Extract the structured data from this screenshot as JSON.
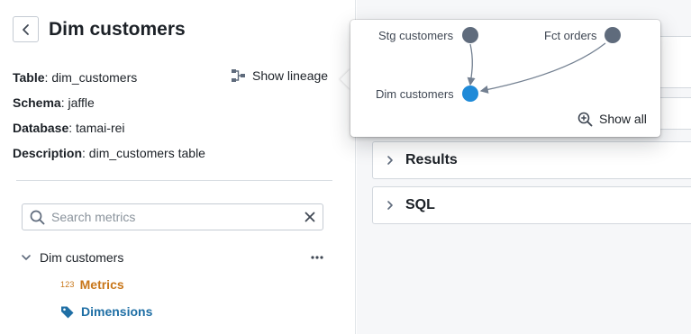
{
  "header": {
    "title": "Dim customers"
  },
  "details": {
    "table_label": "Table",
    "table_value": "dim_customers",
    "schema_label": "Schema",
    "schema_value": "jaffle",
    "database_label": "Database",
    "database_value": "tamai-rei",
    "description_label": "Description",
    "description_value": "dim_customers table"
  },
  "lineage_button": {
    "label": "Show lineage",
    "icon": "lineage-icon"
  },
  "search": {
    "placeholder": "Search metrics",
    "value": ""
  },
  "tree": {
    "root_label": "Dim customers",
    "items": [
      {
        "icon_text": "123",
        "label": "Metrics",
        "color": "#c87619"
      },
      {
        "icon": "tag-icon",
        "label": "Dimensions",
        "color": "#1f6fa5"
      }
    ]
  },
  "sections": [
    {
      "label": "Results"
    },
    {
      "label": "SQL"
    }
  ],
  "lineage_popover": {
    "nodes": [
      {
        "label": "Stg customers",
        "color": "#5f6b7c"
      },
      {
        "label": "Fct orders",
        "color": "#5f6b7c"
      },
      {
        "label": "Dim customers",
        "color": "#1f8ad8",
        "current": true
      }
    ],
    "show_all_label": "Show all"
  }
}
